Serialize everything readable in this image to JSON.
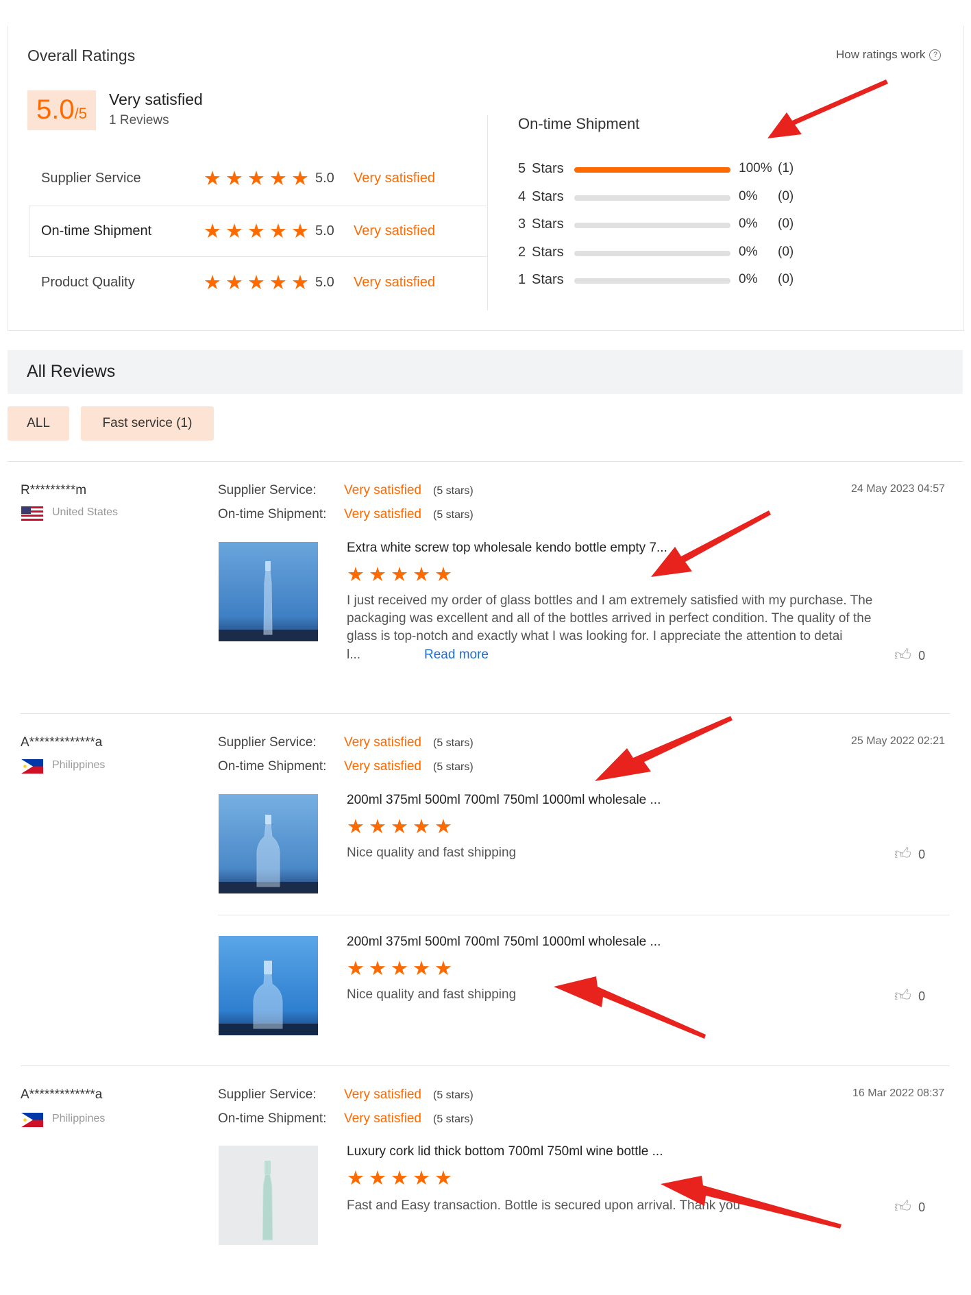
{
  "overall": {
    "title": "Overall Ratings",
    "how_link": "How ratings work",
    "score": "5.0",
    "score_suffix": "/5",
    "verdict": "Very satisfied",
    "reviews_count": "1 Reviews",
    "categories": [
      {
        "label": "Supplier Service",
        "score": "5.0",
        "verdict": "Very satisfied",
        "stars": 5
      },
      {
        "label": "On-time Shipment",
        "score": "5.0",
        "verdict": "Very satisfied",
        "stars": 5
      },
      {
        "label": "Product Quality",
        "score": "5.0",
        "verdict": "Very satisfied",
        "stars": 5
      }
    ]
  },
  "breakdown": {
    "title": "On-time Shipment",
    "rows": [
      {
        "label": "5",
        "stars_word": "Stars",
        "percent": "100%",
        "count": "(1)",
        "fill": 1.0
      },
      {
        "label": "4",
        "stars_word": "Stars",
        "percent": "0%",
        "count": "(0)",
        "fill": 0
      },
      {
        "label": "3",
        "stars_word": "Stars",
        "percent": "0%",
        "count": "(0)",
        "fill": 0
      },
      {
        "label": "2",
        "stars_word": "Stars",
        "percent": "0%",
        "count": "(0)",
        "fill": 0
      },
      {
        "label": "1",
        "stars_word": "Stars",
        "percent": "0%",
        "count": "(0)",
        "fill": 0
      }
    ]
  },
  "all_reviews": {
    "title": "All Reviews",
    "filters": [
      "ALL",
      "Fast service (1)"
    ]
  },
  "reviews": [
    {
      "user": "R*********m",
      "country": "United States",
      "date": "24 May 2023 04:57",
      "supplier_label": "Supplier Service:",
      "supplier_verdict": "Very satisfied",
      "supplier_stars": "(5 stars)",
      "shipment_label": "On-time Shipment:",
      "shipment_verdict": "Very satisfied",
      "shipment_stars": "(5 stars)",
      "items": [
        {
          "product": "Extra white screw top wholesale kendo bottle empty 7...",
          "text_lines": [
            "I just received my order of glass bottles and I am extremely satisfied with my purchase. The",
            "packaging was excellent and all of the bottles arrived in perfect condition. The quality of the",
            "glass is top-notch and exactly what I was looking for. I appreciate the attention to detai"
          ],
          "text_tail": "l...",
          "read_more": "Read more",
          "likes": "0"
        }
      ]
    },
    {
      "user": "A*************a",
      "country": "Philippines",
      "date": "25 May 2022 02:21",
      "supplier_label": "Supplier Service:",
      "supplier_verdict": "Very satisfied",
      "supplier_stars": "(5 stars)",
      "shipment_label": "On-time Shipment:",
      "shipment_verdict": "Very satisfied",
      "shipment_stars": "(5 stars)",
      "items": [
        {
          "product": "200ml 375ml 500ml 700ml 750ml 1000ml wholesale ...",
          "text": "Nice quality and fast shipping",
          "likes": "0"
        },
        {
          "product": "200ml 375ml 500ml 700ml 750ml 1000ml wholesale ...",
          "text": "Nice quality and fast shipping",
          "likes": "0"
        }
      ]
    },
    {
      "user": "A*************a",
      "country": "Philippines",
      "date": "16 Mar 2022 08:37",
      "supplier_label": "Supplier Service:",
      "supplier_verdict": "Very satisfied",
      "supplier_stars": "(5 stars)",
      "shipment_label": "On-time Shipment:",
      "shipment_verdict": "Very satisfied",
      "shipment_stars": "(5 stars)",
      "items": [
        {
          "product": "Luxury cork lid thick bottom 700ml 750ml wine bottle ...",
          "text": "Fast and Easy transaction. Bottle is secured upon arrival. Thank you",
          "likes": "0"
        }
      ]
    }
  ],
  "colors": {
    "accent": "#ff6a00",
    "chip_bg": "#fde3d3",
    "section_bg": "#f2f3f5",
    "arrow": "#e8231d"
  }
}
